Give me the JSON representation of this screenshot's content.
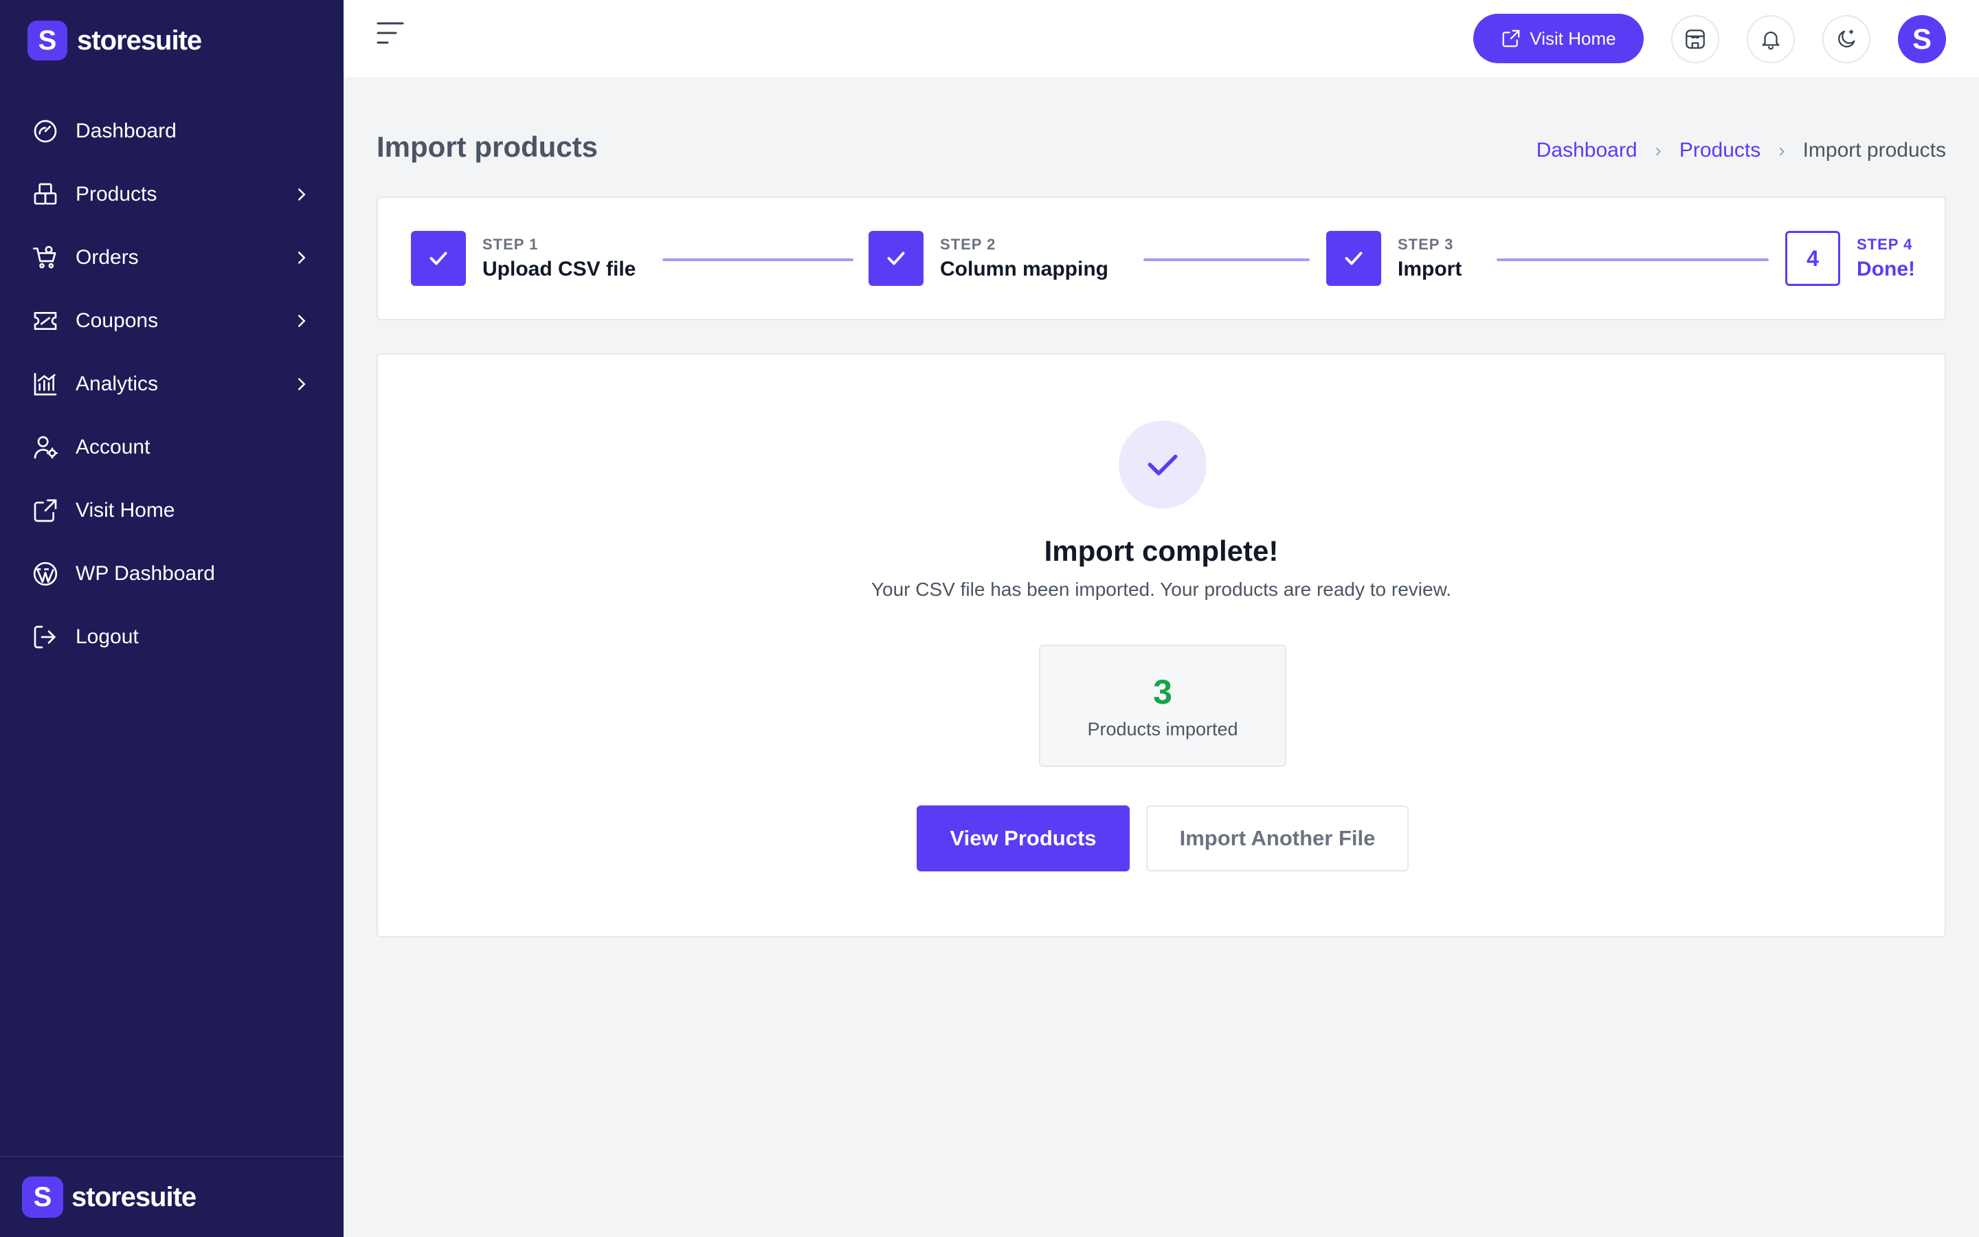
{
  "brand": {
    "name": "storesuite",
    "mark": "S"
  },
  "sidebar": {
    "items": [
      {
        "label": "Dashboard",
        "icon": "dashboard-gauge-icon",
        "has_children": false
      },
      {
        "label": "Products",
        "icon": "products-box-icon",
        "has_children": true
      },
      {
        "label": "Orders",
        "icon": "orders-cart-icon",
        "has_children": true
      },
      {
        "label": "Coupons",
        "icon": "coupon-ticket-icon",
        "has_children": true
      },
      {
        "label": "Analytics",
        "icon": "analytics-chart-icon",
        "has_children": true
      },
      {
        "label": "Account",
        "icon": "account-user-gear-icon",
        "has_children": false
      },
      {
        "label": "Visit Home",
        "icon": "external-link-icon",
        "has_children": false
      },
      {
        "label": "WP Dashboard",
        "icon": "wordpress-icon",
        "has_children": false
      },
      {
        "label": "Logout",
        "icon": "logout-icon",
        "has_children": false
      }
    ]
  },
  "topbar": {
    "visit_home_label": "Visit Home",
    "avatar_initial": "S"
  },
  "page": {
    "title": "Import products",
    "breadcrumb": [
      "Dashboard",
      "Products",
      "Import products"
    ]
  },
  "stepper": {
    "steps": [
      {
        "num": "STEP 1",
        "label": "Upload CSV file",
        "state": "complete"
      },
      {
        "num": "STEP 2",
        "label": "Column mapping",
        "state": "complete"
      },
      {
        "num": "STEP 3",
        "label": "Import",
        "state": "complete"
      },
      {
        "num": "STEP 4",
        "label": "Done!",
        "state": "current",
        "badge": "4"
      }
    ]
  },
  "result": {
    "title": "Import complete!",
    "subtitle": "Your CSV file has been imported. Your products are ready to review.",
    "stat_value": "3",
    "stat_label": "Products imported",
    "primary_button": "View Products",
    "secondary_button": "Import Another File"
  },
  "colors": {
    "sidebar_bg": "#1e1b57",
    "accent": "#5b3cf5",
    "success": "#16a34a",
    "page_bg": "#f3f4f6"
  }
}
